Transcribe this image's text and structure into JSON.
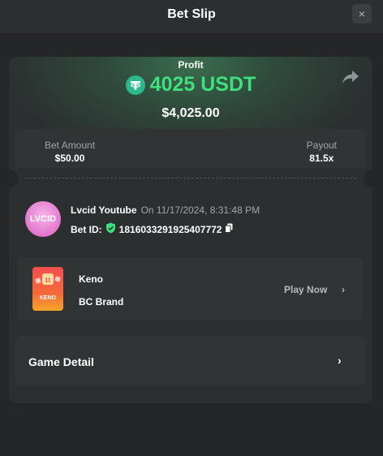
{
  "header": {
    "title": "Bet Slip",
    "close_label": "×"
  },
  "summary": {
    "profit_label": "Profit",
    "profit_amount": "4025 USDT",
    "usd_value": "$4,025.00",
    "currency_icon": "usdt-icon",
    "share_icon": "share-icon"
  },
  "bet": {
    "amount_label": "Bet Amount",
    "amount_value": "$50.00",
    "payout_label": "Payout",
    "payout_value": "81.5x"
  },
  "user": {
    "avatar_text": "LVCID",
    "name": "Lvcid Youtube",
    "timestamp": "On 11/17/2024, 8:31:48 PM",
    "bet_id_label": "Bet ID:",
    "bet_id_value": "18160332919254077​72"
  },
  "game": {
    "name": "Keno",
    "brand": "BC Brand",
    "play_label": "Play Now",
    "chevron": "›",
    "thumb_text": "KENO"
  },
  "detail": {
    "label": "Game Detail",
    "chevron": "›"
  },
  "colors": {
    "accent_green": "#3de07b",
    "usdt": "#2bb88a",
    "background": "#242627",
    "card": "#2c2f30"
  }
}
